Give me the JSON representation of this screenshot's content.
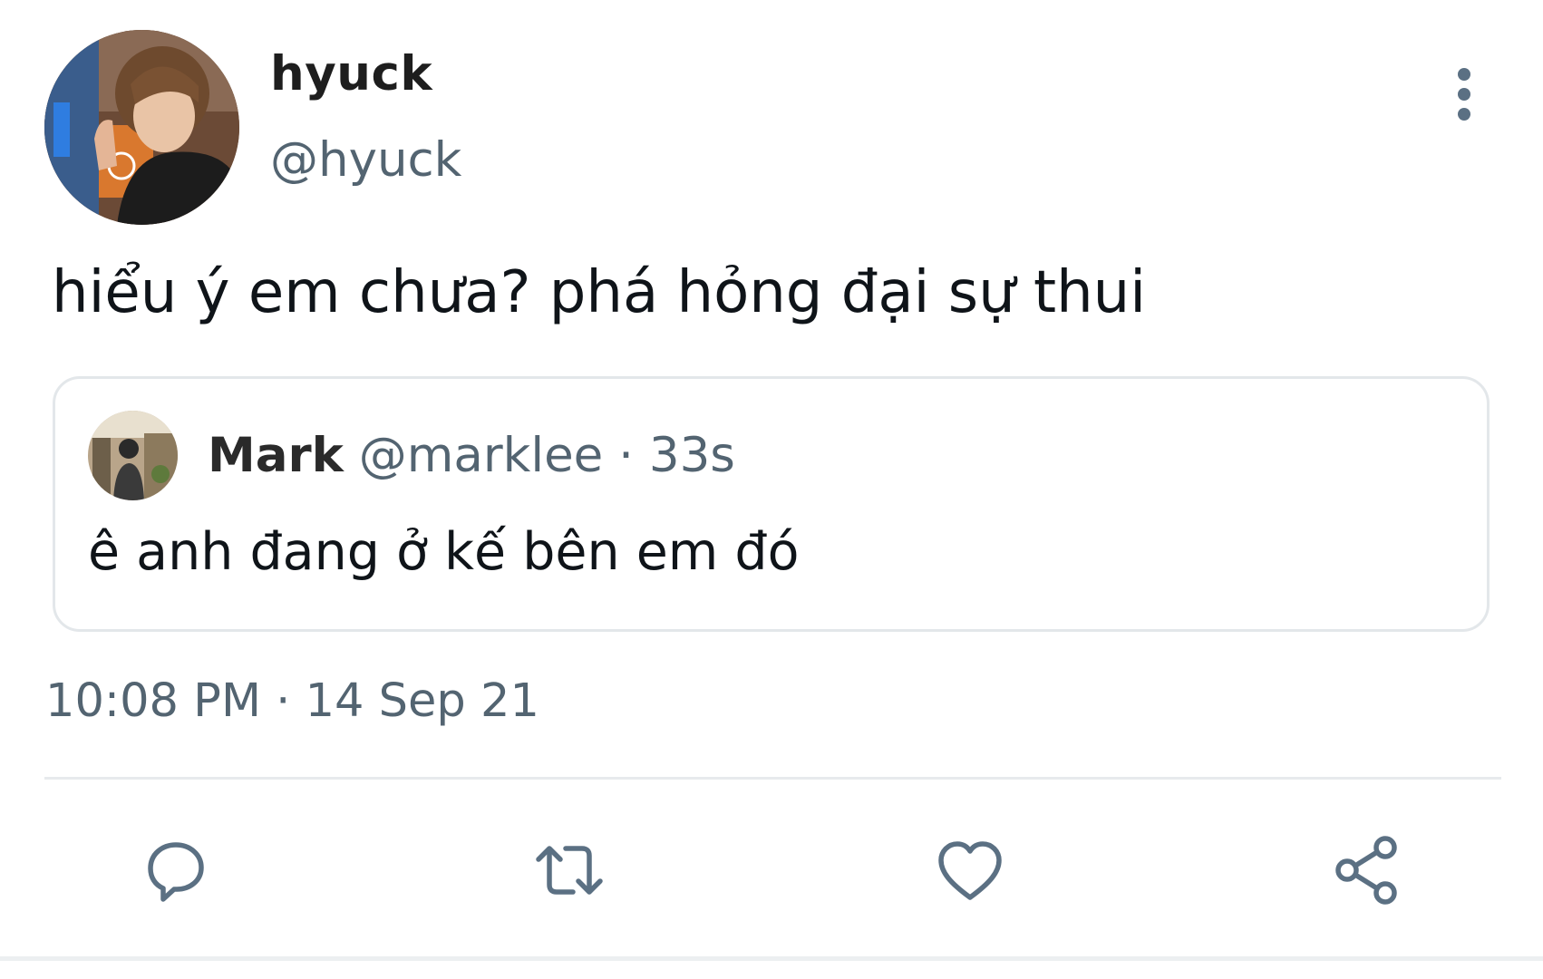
{
  "tweet": {
    "author": {
      "name": "hyuck",
      "handle": "@hyuck"
    },
    "text": "hiểu ý em chưa? phá hỏng đại sự thui",
    "quoted": {
      "name": "Mark",
      "handle": "@marklee",
      "separator": "·",
      "time": "33s",
      "text": "ê anh đang ở kế bên em đó"
    },
    "timestamp": "10:08 PM · 14 Sep 21"
  },
  "actions": [
    {
      "icon": "reply-icon"
    },
    {
      "icon": "retweet-icon"
    },
    {
      "icon": "like-icon"
    },
    {
      "icon": "share-icon"
    }
  ],
  "colors": {
    "secondary_text": "#536471",
    "border": "#e3e7ea",
    "icon": "#5b7083"
  }
}
